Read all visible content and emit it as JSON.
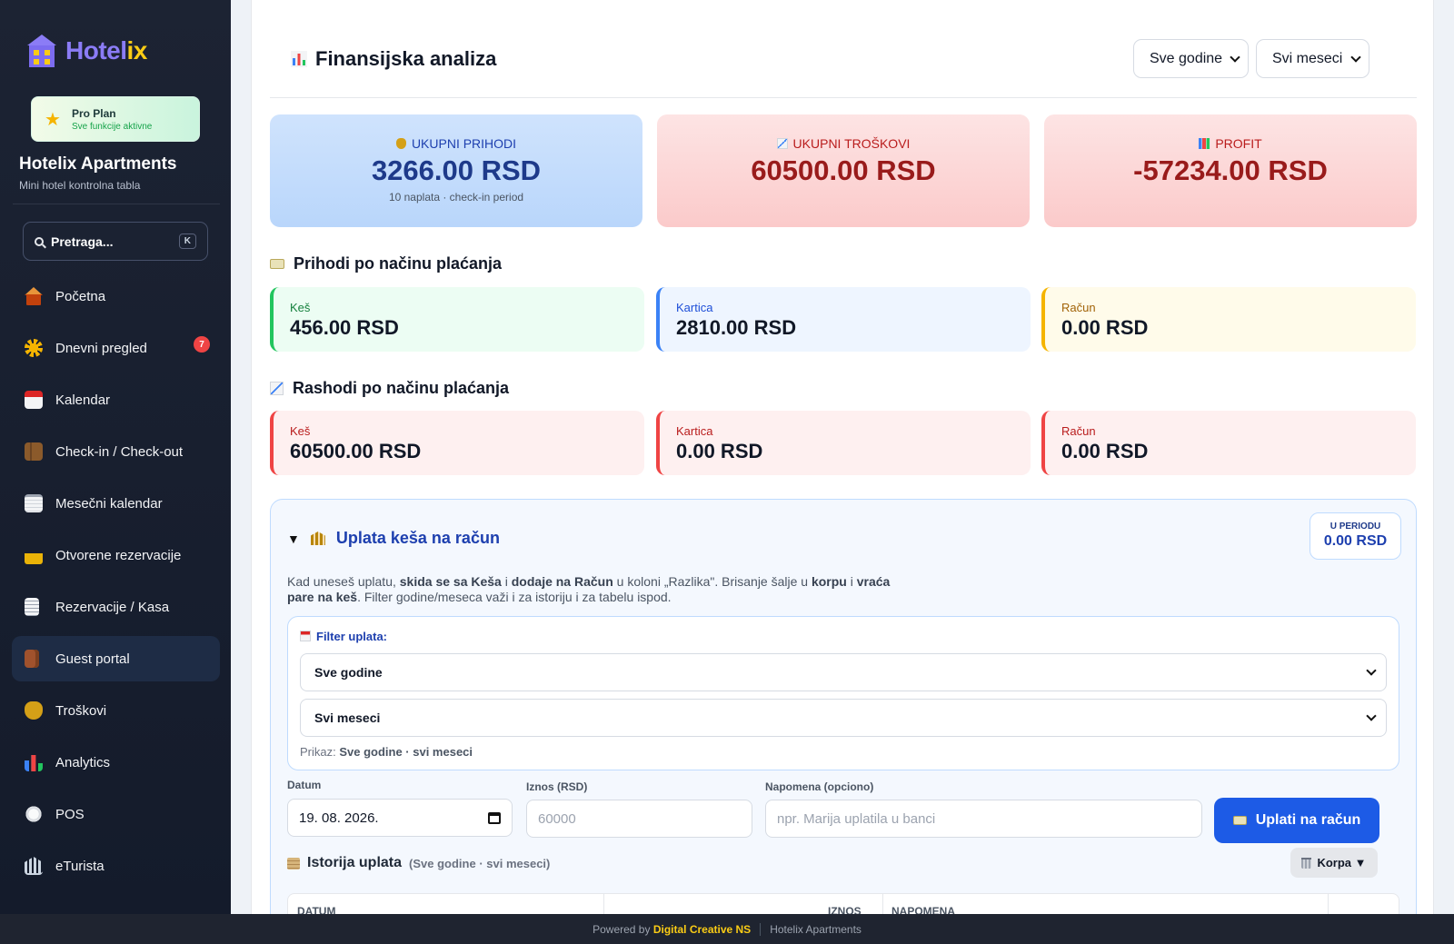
{
  "sidebar": {
    "logo_a": "Hotel",
    "logo_b": "ix",
    "plan_title": "Pro Plan",
    "plan_sub": "Sve funkcije aktivne",
    "hotel_name": "Hotelix Apartments",
    "hotel_sub": "Mini hotel kontrolna tabla",
    "search_placeholder": "Pretraga...",
    "search_shortcut": "K",
    "items": [
      {
        "label": "Početna",
        "icon": "home-icon",
        "color": "#e8943a"
      },
      {
        "label": "Dnevni pregled",
        "icon": "sun-icon",
        "color": "#f5b400",
        "badge": "7"
      },
      {
        "label": "Kalendar",
        "icon": "calendar-icon",
        "color": "#dc2626"
      },
      {
        "label": "Check-in / Check-out",
        "icon": "luggage-icon",
        "color": "#8b5a2b"
      },
      {
        "label": "Mesečni kalendar",
        "icon": "notepad-icon",
        "color": "#e5e7eb"
      },
      {
        "label": "Otvorene rezervacije",
        "icon": "lock-icon",
        "color": "#eab308"
      },
      {
        "label": "Rezervacije / Kasa",
        "icon": "receipt-icon",
        "color": "#f3f4f6"
      },
      {
        "label": "Guest portal",
        "icon": "door-icon",
        "color": "#a0522d"
      },
      {
        "label": "Troškovi",
        "icon": "money-bag-icon",
        "color": "#d4a017"
      },
      {
        "label": "Analytics",
        "icon": "bar-chart-icon",
        "color": "#22c55e"
      },
      {
        "label": "POS",
        "icon": "plate-icon",
        "color": "#e5e7eb"
      },
      {
        "label": "eTurista",
        "icon": "government-icon",
        "color": "#cbd5e1"
      }
    ]
  },
  "header": {
    "icon": "bar-chart-icon",
    "title": "Finansijska analiza",
    "year_select": "Sve godine",
    "month_select": "Svi meseci"
  },
  "stats": {
    "income": {
      "label": "UKUPNI PRIHODI",
      "value": "3266.00 RSD",
      "sub": "10 naplata · check-in period",
      "icon": "money-bag-icon"
    },
    "expenses": {
      "label": "UKUPNI TROŠKOVI",
      "value": "60500.00 RSD",
      "icon": "chart-down-icon"
    },
    "profit": {
      "label": "PROFIT",
      "value": "-57234.00 RSD",
      "icon": "bar-chart-icon"
    }
  },
  "income_by_method": {
    "title": "Prihodi po načinu plaćanja",
    "cash": {
      "label": "Keš",
      "value": "456.00 RSD"
    },
    "card": {
      "label": "Kartica",
      "value": "2810.00 RSD"
    },
    "invoice": {
      "label": "Račun",
      "value": "0.00 RSD"
    }
  },
  "expenses_by_method": {
    "title": "Rashodi po načinu plaćanja",
    "cash": {
      "label": "Keš",
      "value": "60500.00 RSD"
    },
    "card": {
      "label": "Kartica",
      "value": "0.00 RSD"
    },
    "invoice": {
      "label": "Račun",
      "value": "0.00 RSD"
    }
  },
  "cash_deposit": {
    "title": "Uplata keša na račun",
    "period_label": "U PERIODU",
    "period_value": "0.00 RSD",
    "desc": {
      "p1": "Kad uneseš uplatu, ",
      "b1": "skida se sa Keša",
      "p2": " i ",
      "b2": "dodaje na Račun",
      "p3": " u koloni „Razlika\". Brisanje šalje u ",
      "b3": "korpu",
      "p4": " i ",
      "b4": "vraća pare na keš",
      "p5": ". Filter godine/meseca važi i za istoriju i za tabelu ispod."
    },
    "filter_title": "Filter uplata:",
    "filter_year": "Sve godine",
    "filter_month": "Svi meseci",
    "filter_display_label": "Prikaz: ",
    "filter_display_value": "Sve godine · svi meseci",
    "date_label": "Datum",
    "date_value": "19. 08. 2026.",
    "amount_label": "Iznos (RSD)",
    "amount_placeholder": "60000",
    "note_label": "Napomena (opciono)",
    "note_placeholder": "npr. Marija uplatila u banci",
    "pay_button": "Uplati na račun",
    "history_title": "Istorija uplata",
    "history_sub": "(Sve godine · svi meseci)",
    "trash_button": "Korpa ▼",
    "table_headers": [
      "DATUM",
      "IZNOS",
      "NAPOMENA"
    ]
  },
  "footer": {
    "powered": "Powered by",
    "brand": "Digital Creative NS",
    "app": "Hotelix Apartments"
  }
}
